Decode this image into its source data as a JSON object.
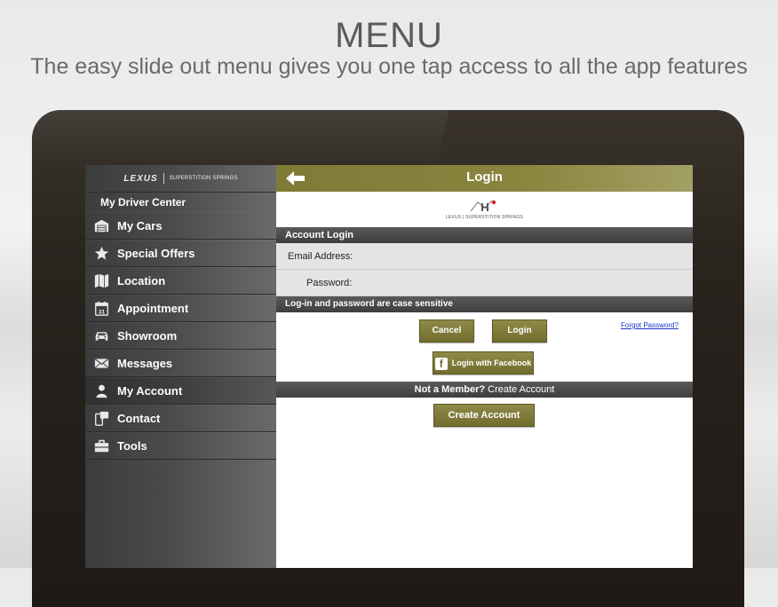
{
  "promo": {
    "headline": "MENU",
    "subline": "The easy slide out menu gives you one tap access to all the app features"
  },
  "sidebar": {
    "brand_logo": "LEXUS",
    "brand_dealer": "SUPERSTITION SPRINGS",
    "section_title": "My Driver Center",
    "items": [
      {
        "label": "My Cars",
        "icon": "garage-icon"
      },
      {
        "label": "Special Offers",
        "icon": "star-icon"
      },
      {
        "label": "Location",
        "icon": "map-icon"
      },
      {
        "label": "Appointment",
        "icon": "calendar-icon",
        "icon_text": "31"
      },
      {
        "label": "Showroom",
        "icon": "car-icon"
      },
      {
        "label": "Messages",
        "icon": "envelope-icon"
      },
      {
        "label": "My Account",
        "icon": "person-icon"
      },
      {
        "label": "Contact",
        "icon": "phone-icon"
      },
      {
        "label": "Tools",
        "icon": "toolbox-icon"
      }
    ]
  },
  "login": {
    "title": "Login",
    "dealer_mark": "LEXUS | SUPERSTITION SPRINGS",
    "account_login": "Account Login",
    "email_label": "Email Address:",
    "password_label": "Password:",
    "case_note": "Log-in and password are case sensitive",
    "cancel_label": "Cancel",
    "login_label": "Login",
    "forgot_label": "Forgot Password?",
    "facebook_label": "Login with Facebook",
    "member_prompt": "Not a Member?",
    "member_link": "Create Account",
    "create_account_label": "Create Account"
  },
  "colors": {
    "accent_olive": "#7f7a36",
    "sidebar_dark": "#3c3c3c",
    "link_blue": "#1a35c8"
  }
}
